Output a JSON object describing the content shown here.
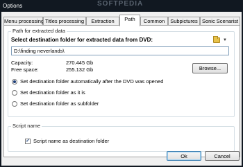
{
  "window": {
    "title": "Options",
    "watermark": "SOFTPEDIA"
  },
  "tabs": [
    {
      "label": "Menu processing",
      "active": false
    },
    {
      "label": "Titles processing",
      "active": false
    },
    {
      "label": "Extraction",
      "active": false
    },
    {
      "label": "Path",
      "active": true
    },
    {
      "label": "Common",
      "active": false
    },
    {
      "label": "Subpictures",
      "active": false
    },
    {
      "label": "Sonic Scenarist",
      "active": false
    }
  ],
  "path_group": {
    "title": "Path for extracted data",
    "heading": "Select destination folder for extracted data from DVD:",
    "path_value": "D:\\finding neverlands\\",
    "capacity_label": "Capacity:",
    "capacity_value": "270.445 Gb",
    "free_label": "Free space:",
    "free_value": "255.132 Gb",
    "browse_label": "Browse...",
    "options": [
      {
        "label": "Set destination folder automatically after the DVD was opened",
        "selected": true
      },
      {
        "label": "Set destination folder as it is",
        "selected": false
      },
      {
        "label": "Set destination folder as subfolder",
        "selected": false
      }
    ]
  },
  "script_group": {
    "title": "Script name",
    "checkbox_label": "Script name as destination folder",
    "checked": true
  },
  "footer": {
    "ok_label": "Ok",
    "cancel_label": "Cancel"
  },
  "icons": {
    "folder": "folder-icon",
    "dropdown": "chevron-down-icon"
  }
}
